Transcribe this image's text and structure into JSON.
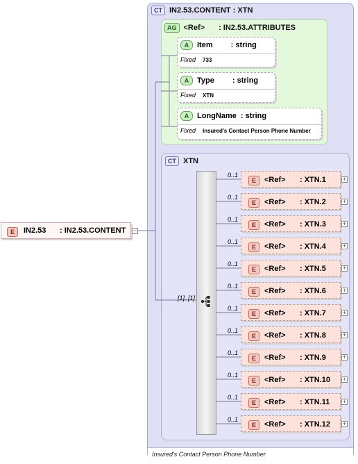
{
  "root": {
    "tag": "E",
    "name": "IN2.53",
    "type": ": IN2.53.CONTENT"
  },
  "complex_type": {
    "tag": "CT",
    "title": "IN2.53.CONTENT : XTN",
    "footer": "Insured's Contact Person Phone Number"
  },
  "attribute_group": {
    "tag": "AG",
    "ref": "<Ref>",
    "name": ": IN2.53.ATTRIBUTES",
    "attributes": [
      {
        "tag": "A",
        "name": "Item",
        "type": ": string",
        "fixed_label": "Fixed",
        "fixed_value": "733"
      },
      {
        "tag": "A",
        "name": "Type",
        "type": ": string",
        "fixed_label": "Fixed",
        "fixed_value": "XTN"
      },
      {
        "tag": "A",
        "name": "LongName",
        "type": ": string",
        "fixed_label": "Fixed",
        "fixed_value": "Insured's Contact Person Phone Number"
      }
    ]
  },
  "inner_type": {
    "tag": "CT",
    "title": "XTN"
  },
  "sequence": {
    "occurrence": "[1]..[1]",
    "icon": "sequence-icon"
  },
  "elements": [
    {
      "tag": "E",
      "ref": "<Ref>",
      "name": ": XTN.1",
      "occurrence": "0..1"
    },
    {
      "tag": "E",
      "ref": "<Ref>",
      "name": ": XTN.2",
      "occurrence": "0..1"
    },
    {
      "tag": "E",
      "ref": "<Ref>",
      "name": ": XTN.3",
      "occurrence": "0..1"
    },
    {
      "tag": "E",
      "ref": "<Ref>",
      "name": ": XTN.4",
      "occurrence": "0..1"
    },
    {
      "tag": "E",
      "ref": "<Ref>",
      "name": ": XTN.5",
      "occurrence": "0..1"
    },
    {
      "tag": "E",
      "ref": "<Ref>",
      "name": ": XTN.6",
      "occurrence": "0..1"
    },
    {
      "tag": "E",
      "ref": "<Ref>",
      "name": ": XTN.7",
      "occurrence": "0..1"
    },
    {
      "tag": "E",
      "ref": "<Ref>",
      "name": ": XTN.8",
      "occurrence": "0..1"
    },
    {
      "tag": "E",
      "ref": "<Ref>",
      "name": ": XTN.9",
      "occurrence": "0..1"
    },
    {
      "tag": "E",
      "ref": "<Ref>",
      "name": ": XTN.10",
      "occurrence": "0..1"
    },
    {
      "tag": "E",
      "ref": "<Ref>",
      "name": ": XTN.11",
      "occurrence": "0..1"
    },
    {
      "tag": "E",
      "ref": "<Ref>",
      "name": ": XTN.12",
      "occurrence": "0..1"
    }
  ]
}
